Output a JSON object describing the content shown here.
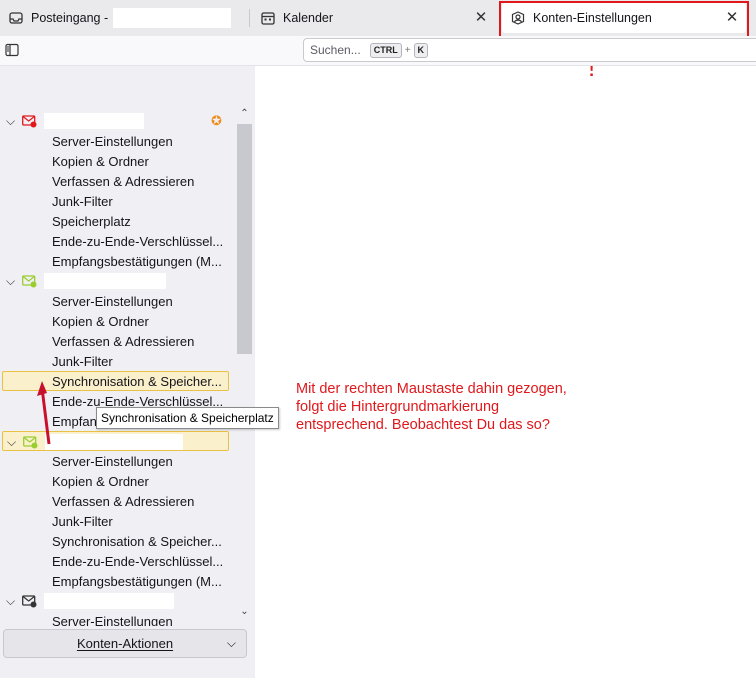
{
  "tabs": [
    {
      "label": "Posteingang -",
      "icon": "inbox-icon"
    },
    {
      "label": "Kalender",
      "icon": "calendar-icon"
    },
    {
      "label": "Konten-Einstellungen",
      "icon": "account-settings-icon"
    }
  ],
  "toolbar": {
    "search_placeholder": "Suchen...",
    "shortcut_key1": "CTRL",
    "shortcut_plus": "+",
    "shortcut_key2": "K"
  },
  "accounts": [
    {
      "icon_color": "#e0181c",
      "items": [
        "Server-Einstellungen",
        "Kopien & Ordner",
        "Verfassen & Adressieren",
        "Junk-Filter",
        "Speicherplatz",
        "Ende-zu-Ende-Verschlüssel...",
        "Empfangsbestätigungen (M..."
      ]
    },
    {
      "icon_color": "#9acd32",
      "items": [
        "Server-Einstellungen",
        "Kopien & Ordner",
        "Verfassen & Adressieren",
        "Junk-Filter",
        "Synchronisation & Speicher...",
        "Ende-zu-Ende-Verschlüssel...",
        "Empfangsbestätigungen (M..."
      ]
    },
    {
      "icon_color": "#9acd32",
      "items": [
        "Server-Einstellungen",
        "Kopien & Ordner",
        "Verfassen & Adressieren",
        "Junk-Filter",
        "Synchronisation & Speicher...",
        "Ende-zu-Ende-Verschlüssel...",
        "Empfangsbestätigungen (M..."
      ]
    },
    {
      "icon_color": "#333333",
      "items": [
        "Server-Einstellungen"
      ]
    }
  ],
  "tooltip": "Synchronisation & Speicherplatz",
  "actions_label": "Konten-Aktionen",
  "annotation": {
    "exclamation": "!",
    "note": "Mit der rechten Maustaste dahin gezogen, folgt die Hintergrundmarkierung entsprechend. Beobachtest Du das so?"
  }
}
